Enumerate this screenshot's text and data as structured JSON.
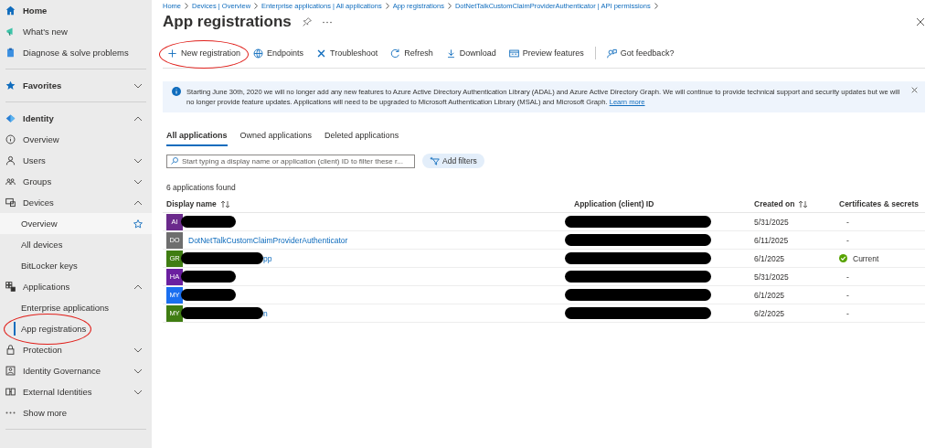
{
  "breadcrumb": [
    "Home",
    "Devices | Overview",
    "Enterprise applications | All applications",
    "App registrations",
    "DotNetTalkCustomClaimProviderAuthenticator | API permissions"
  ],
  "sidebar": {
    "items": [
      {
        "label": "Home",
        "kind": "top",
        "selected": false,
        "highlighted": false
      },
      {
        "label": "What's new",
        "kind": "plain",
        "selected": false,
        "highlighted": false
      },
      {
        "label": "Diagnose & solve problems",
        "kind": "plain",
        "selected": false,
        "highlighted": false,
        "divider_after": true
      },
      {
        "label": "Favorites",
        "kind": "top",
        "selected": false,
        "highlighted": false,
        "expanded": false,
        "divider_after": true
      },
      {
        "label": "Identity",
        "kind": "top",
        "selected": false,
        "highlighted": false,
        "expanded": true
      },
      {
        "label": "Overview",
        "kind": "plain",
        "selected": false,
        "highlighted": false
      },
      {
        "label": "Users",
        "kind": "plain",
        "selected": false,
        "highlighted": false,
        "expanded": false
      },
      {
        "label": "Groups",
        "kind": "plain",
        "selected": false,
        "highlighted": false,
        "expanded": false
      },
      {
        "label": "Devices",
        "kind": "plain",
        "selected": false,
        "highlighted": false,
        "expanded": true
      },
      {
        "label": "Overview",
        "kind": "child",
        "selected": false,
        "highlighted": true
      },
      {
        "label": "All devices",
        "kind": "child",
        "selected": false,
        "highlighted": false
      },
      {
        "label": "BitLocker keys",
        "kind": "child",
        "selected": false,
        "highlighted": false
      },
      {
        "label": "Applications",
        "kind": "plain",
        "selected": false,
        "highlighted": false,
        "expanded": true
      },
      {
        "label": "Enterprise applications",
        "kind": "child",
        "selected": false,
        "highlighted": false
      },
      {
        "label": "App registrations",
        "kind": "child",
        "selected": true,
        "highlighted": false,
        "circled": true
      },
      {
        "label": "Protection",
        "kind": "plain",
        "selected": false,
        "highlighted": false,
        "expanded": false
      },
      {
        "label": "Identity Governance",
        "kind": "plain",
        "selected": false,
        "highlighted": false,
        "expanded": false
      },
      {
        "label": "External Identities",
        "kind": "plain",
        "selected": false,
        "highlighted": false,
        "expanded": false
      },
      {
        "label": "Show more",
        "kind": "plain",
        "selected": false,
        "highlighted": false,
        "divider_after": true
      }
    ]
  },
  "title": "App registrations",
  "toolbar": [
    {
      "label": "New registration",
      "circled": true
    },
    {
      "label": "Endpoints",
      "circled": false
    },
    {
      "label": "Troubleshoot",
      "circled": false
    },
    {
      "label": "Refresh",
      "circled": false
    },
    {
      "label": "Download",
      "circled": false
    },
    {
      "label": "Preview features",
      "circled": false
    },
    {
      "label": "Got feedback?",
      "circled": false
    }
  ],
  "banner": {
    "text": "Starting June 30th, 2020 we will no longer add any new features to Azure Active Directory Authentication Library (ADAL) and Azure Active Directory Graph. We will continue to provide technical support and security updates but we will no longer provide feature updates. Applications will need to be upgraded to Microsoft Authentication Library (MSAL) and Microsoft Graph.",
    "link": "Learn more"
  },
  "tabs": [
    {
      "label": "All applications",
      "selected": true
    },
    {
      "label": "Owned applications",
      "selected": false
    },
    {
      "label": "Deleted applications",
      "selected": false
    }
  ],
  "search": {
    "placeholder": "Start typing a display name or application (client) ID to filter these r..."
  },
  "add_filters": "Add filters",
  "count": "6 applications found",
  "table": {
    "columns": [
      {
        "label": "Display name",
        "sortable": true
      },
      {
        "label": "Application (client) ID",
        "sortable": false
      },
      {
        "label": "Created on",
        "sortable": true
      },
      {
        "label": "Certificates & secrets",
        "sortable": false
      }
    ],
    "rows": [
      {
        "initials": "AI",
        "color": "#6b2a8c",
        "name_redacted": true,
        "id_redacted": true,
        "created": "5/31/2025",
        "certs": "-",
        "cert_valid": false
      },
      {
        "initials": "DO",
        "color": "#6e6e6e",
        "name": "DotNetTalkCustomClaimProviderAuthenticator",
        "name_redacted": false,
        "id_redacted": true,
        "created": "6/11/2025",
        "certs": "-",
        "cert_valid": false
      },
      {
        "initials": "GR",
        "color": "#3f7d12",
        "name": "pp",
        "name_redacted": true,
        "id_redacted": true,
        "created": "6/1/2025",
        "certs": "Current",
        "cert_valid": true
      },
      {
        "initials": "HA",
        "color": "#6b1fa0",
        "name_redacted": true,
        "id_redacted": true,
        "created": "5/31/2025",
        "certs": "-",
        "cert_valid": false
      },
      {
        "initials": "MY",
        "color": "#1a6ff0",
        "name_redacted": true,
        "id_redacted": true,
        "created": "6/1/2025",
        "certs": "-",
        "cert_valid": false
      },
      {
        "initials": "MY",
        "color": "#3f7d12",
        "name": "n",
        "name_redacted": true,
        "id_redacted": true,
        "created": "6/2/2025",
        "certs": "-",
        "cert_valid": false
      }
    ]
  }
}
